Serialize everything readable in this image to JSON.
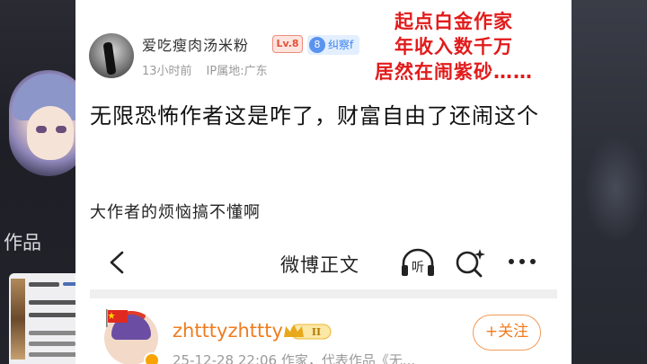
{
  "background": {
    "works_label": "作品"
  },
  "post": {
    "username": "爱吃瘦肉汤米粉",
    "level_badge": "Lv.8",
    "verify_icon_text": "8",
    "verify_badge_text": "纠察f",
    "time": "13小时前",
    "ip_location": "IP属地:广东",
    "title": "无限恐怖作者这是咋了，财富自由了还闹这个",
    "subtitle": "大作者的烦恼搞不懂啊"
  },
  "overlay_caption": {
    "line1": "起点白金作家",
    "line2": "年收入数千万",
    "line3": "居然在闹紫砂……"
  },
  "embedded": {
    "nav_title": "微博正文",
    "listen_glyph": "听",
    "author_name": "zhtttyzhttty",
    "level_roman": "II",
    "follow_label": "+关注",
    "meta_text": "25-12-28 22:06  作家，代表作品《无..."
  },
  "colors": {
    "caption": "#e21b1b",
    "author_name": "#f07c1e",
    "follow_border": "#f29a56",
    "level_badge": "#e0533b",
    "verify_badge": "#3b82f0"
  }
}
